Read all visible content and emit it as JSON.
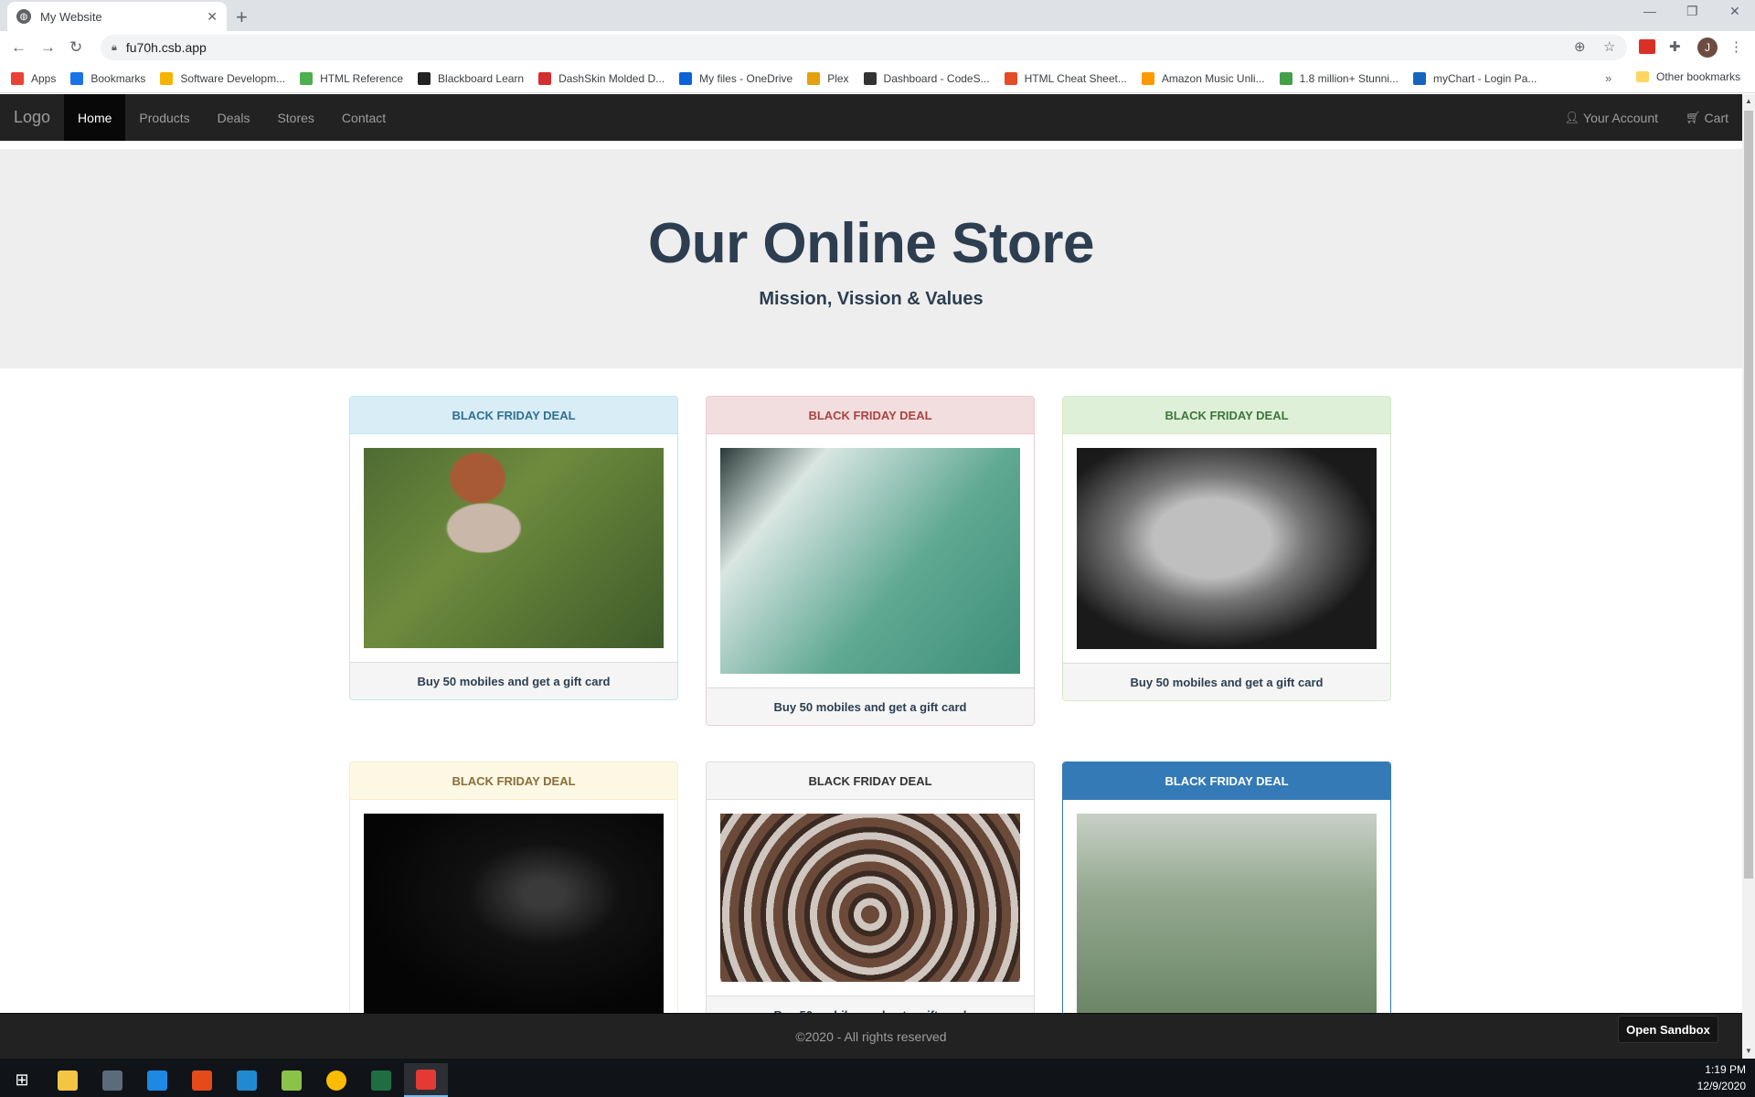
{
  "browser": {
    "tab_title": "My Website",
    "url": "fu70h.csb.app",
    "bookmarks": [
      {
        "label": "Apps",
        "icon": "apps-grid-icon",
        "color": "#ea4335"
      },
      {
        "label": "Bookmarks",
        "icon": "star-icon",
        "color": "#1a73e8"
      },
      {
        "label": "Software Developm...",
        "icon": "gear-icon",
        "color": "#f4b400"
      },
      {
        "label": "HTML Reference",
        "icon": "w3-icon",
        "color": "#4caf50"
      },
      {
        "label": "Blackboard Learn",
        "icon": "blackboard-icon",
        "color": "#222222"
      },
      {
        "label": "DashSkin Molded D...",
        "icon": "ds-icon",
        "color": "#d32f2f"
      },
      {
        "label": "My files - OneDrive",
        "icon": "cloud-icon",
        "color": "#0a64d6"
      },
      {
        "label": "Plex",
        "icon": "plex-icon",
        "color": "#e5a00d"
      },
      {
        "label": "Dashboard - CodeS...",
        "icon": "codesandbox-icon",
        "color": "#333333"
      },
      {
        "label": "HTML Cheat Sheet...",
        "icon": "shield-icon",
        "color": "#e44d26"
      },
      {
        "label": "Amazon Music Unli...",
        "icon": "amazon-icon",
        "color": "#ff9900"
      },
      {
        "label": "1.8 million+ Stunni...",
        "icon": "px-icon",
        "color": "#43a047"
      },
      {
        "label": "myChart - Login Pa...",
        "icon": "calendar-icon",
        "color": "#1565c0"
      }
    ],
    "other_bookmarks": "Other bookmarks",
    "more_bookmarks": "»",
    "profile_initial": "J"
  },
  "site": {
    "brand": "Logo",
    "nav": [
      {
        "label": "Home",
        "active": true
      },
      {
        "label": "Products",
        "active": false
      },
      {
        "label": "Deals",
        "active": false
      },
      {
        "label": "Stores",
        "active": false
      },
      {
        "label": "Contact",
        "active": false
      }
    ],
    "account": "Your Account",
    "cart": "Cart",
    "hero_title": "Our Online Store",
    "hero_subtitle": "Mission, Vission & Values",
    "cards": [
      {
        "heading": "BLACK FRIDAY DEAL",
        "footer": "Buy 50 mobiles and get a gift card",
        "style": "info",
        "image": "child-in-grass-photo"
      },
      {
        "heading": "BLACK FRIDAY DEAL",
        "footer": "Buy 50 mobiles and get a gift card",
        "style": "danger",
        "image": "aerial-ice-photo"
      },
      {
        "heading": "BLACK FRIDAY DEAL",
        "footer": "Buy 50 mobiles and get a gift card",
        "style": "success",
        "image": "bw-figure-photo"
      },
      {
        "heading": "BLACK FRIDAY DEAL",
        "footer": "",
        "style": "warning",
        "image": "dark-portrait-photo"
      },
      {
        "heading": "BLACK FRIDAY DEAL",
        "footer": "Buy 50 mobiles and get a gift card",
        "style": "default",
        "image": "spiral-staircase-photo"
      },
      {
        "heading": "BLACK FRIDAY DEAL",
        "footer": "",
        "style": "primary",
        "image": "grass-field-photo"
      }
    ],
    "footer_text": "©2020 - All rights reserved",
    "open_sandbox": "Open Sandbox"
  },
  "taskbar": {
    "time": "1:19 PM",
    "date": "12/9/2020"
  },
  "colors": {
    "navbar": "#222222",
    "hero_text": "#2c3e50",
    "primary": "#337ab7"
  }
}
